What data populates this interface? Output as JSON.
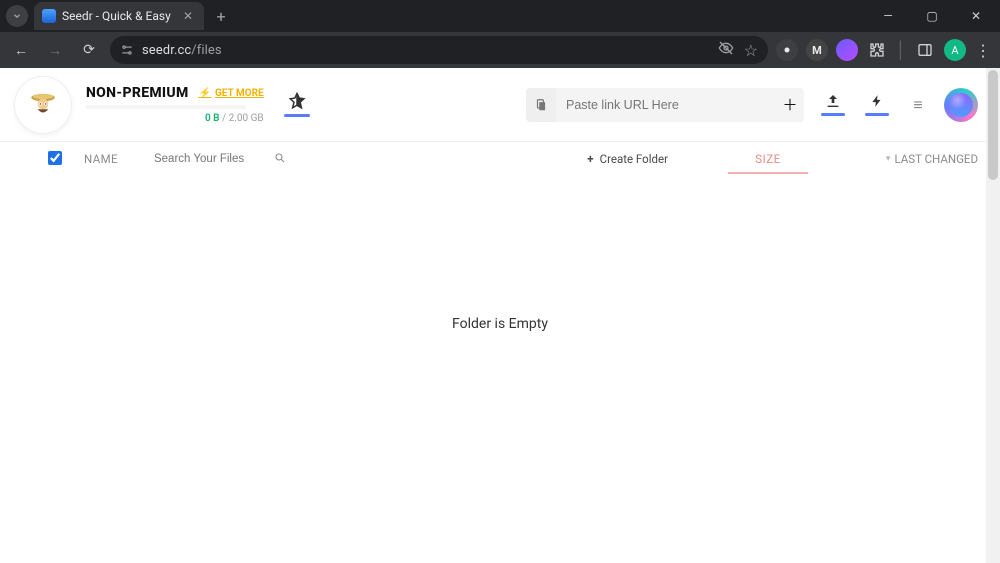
{
  "browser": {
    "tab_title": "Seedr - Quick & Easy",
    "url_host": "seedr.cc",
    "url_path": "/files"
  },
  "header": {
    "account_tier": "NON-PREMIUM",
    "get_more_label": "GET MORE",
    "quota_used": "0 B",
    "quota_sep": " / ",
    "quota_total": "2.00 GB",
    "paste_placeholder": "Paste link URL Here"
  },
  "columns": {
    "name": "NAME",
    "search_placeholder": "Search Your Files",
    "create_folder": "Create Folder",
    "size": "SIZE",
    "last_changed": "LAST CHANGED"
  },
  "main": {
    "empty_text": "Folder is Empty"
  }
}
